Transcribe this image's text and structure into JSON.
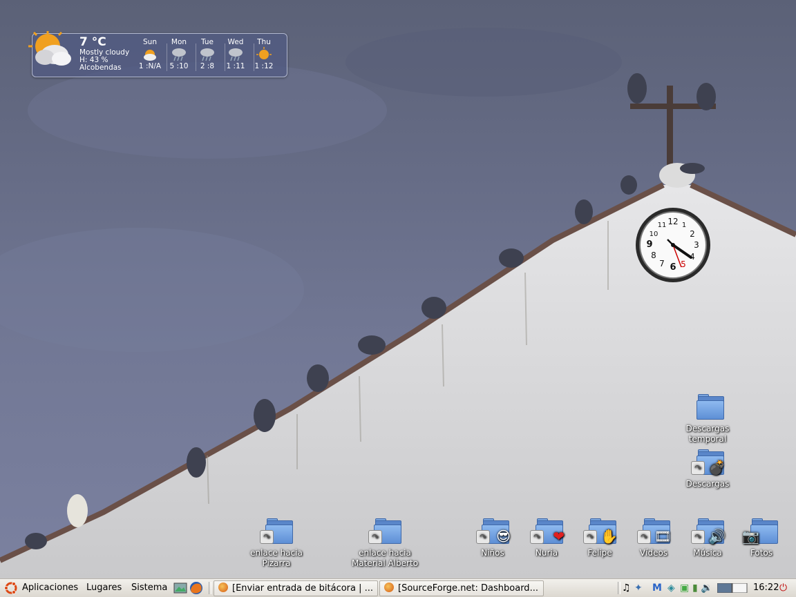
{
  "weather": {
    "temperature": "7 °C",
    "condition": "Mostly cloudy",
    "humidity": "H: 43 %",
    "location": "Alcobendas",
    "forecast": [
      {
        "day": "Sun",
        "temps": "1 :N/A",
        "icon": "sun-cloud-icon"
      },
      {
        "day": "Mon",
        "temps": "5 :10",
        "icon": "rain-cloud-icon"
      },
      {
        "day": "Tue",
        "temps": "2 :8",
        "icon": "rain-cloud-icon"
      },
      {
        "day": "Wed",
        "temps": "1 :11",
        "icon": "rain-cloud-icon"
      },
      {
        "day": "Thu",
        "temps": "1 :12",
        "icon": "sun-icon"
      }
    ]
  },
  "clock": {
    "numbers": [
      "12",
      "1",
      "2",
      "3",
      "4",
      "5",
      "6",
      "7",
      "8",
      "9",
      "10",
      "11"
    ],
    "time": "4:21"
  },
  "desktop_icons": {
    "descargas_temporal": "Descargas temporal",
    "descargas": "Descargas",
    "pizarra_line1": "enlace hacia Pizarra",
    "alberto_line1": "enlace hacia",
    "alberto_line2": "Material Alberto",
    "ninos": "Niños",
    "nuria": "Nuria",
    "felipe": "Felipe",
    "videos": "Vídeos",
    "musica": "Música",
    "fotos": "Fotos"
  },
  "panel": {
    "applications": "Aplicaciones",
    "places": "Lugares",
    "system": "Sistema",
    "task1": "[Enviar entrada de bitácora | ...",
    "task2": "[SourceForge.net: Dashboard...",
    "clock": "16:22"
  }
}
